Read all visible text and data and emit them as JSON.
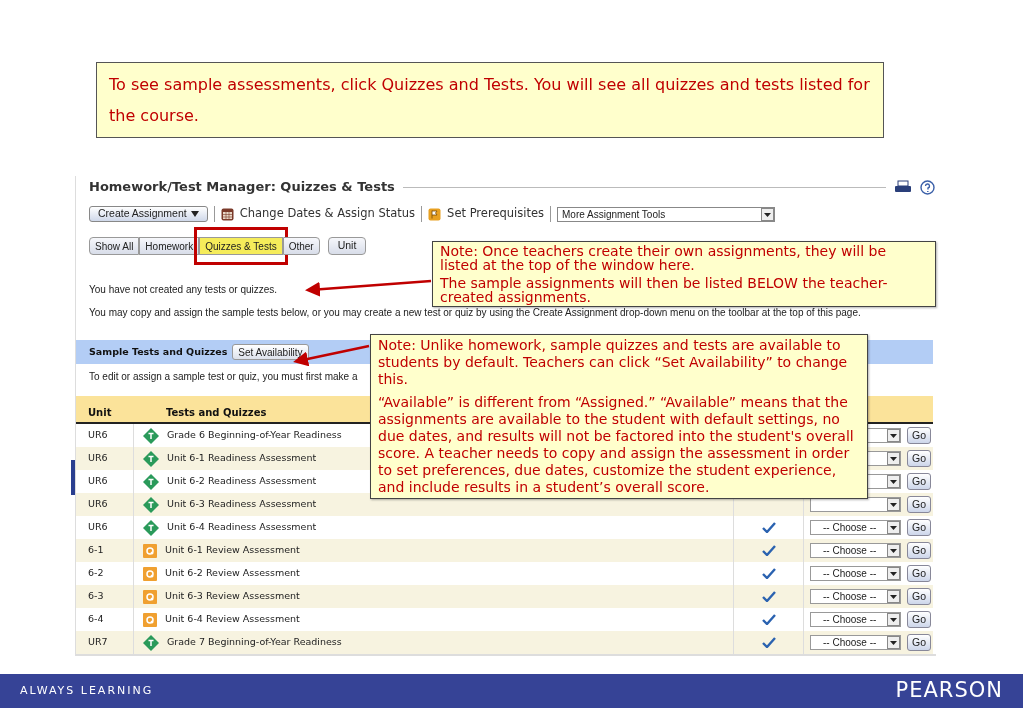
{
  "caption": "To see sample assessments, click Quizzes and Tests. You will see all quizzes and tests listed for the course.",
  "page": {
    "title": "Homework/Test Manager: Quizzes & Tests",
    "toolbar": {
      "create_button": "Create Assignment",
      "change_dates": "Change Dates & Assign Status",
      "prerequisites": "Set Prerequisites",
      "more_tools": "More Assignment Tools"
    },
    "filters": [
      {
        "label": "Show All",
        "selected": false
      },
      {
        "label": "Homework",
        "selected": false
      },
      {
        "label": "Quizzes & Tests",
        "selected": true
      },
      {
        "label": "Other",
        "selected": false
      }
    ],
    "unit_button": "Unit",
    "messages": [
      "You have not created any tests or quizzes.",
      "You may copy and assign the sample tests below, or you may create a new test or quiz by using the Create Assignment drop-down menu on the toolbar at the top of this page."
    ],
    "sample_section": {
      "title": "Sample Tests and Quizzes",
      "button": "Set Availability",
      "note": "To edit or assign a sample test or quiz, you must first make a"
    },
    "table": {
      "columns": [
        "Unit",
        "Tests and Quizzes"
      ],
      "rows": [
        {
          "unit": "UR6",
          "kind": "test",
          "title": "Grade 6 Beginning-of-Year Readiness",
          "go": "Go"
        },
        {
          "unit": "UR6",
          "kind": "test",
          "title": "Unit 6-1 Readiness Assessment",
          "go": "Go"
        },
        {
          "unit": "UR6",
          "kind": "test",
          "title": "Unit 6-2 Readiness Assessment",
          "go": "Go"
        },
        {
          "unit": "UR6",
          "kind": "test",
          "title": "Unit 6-3 Readiness Assessment",
          "go": "Go"
        },
        {
          "unit": "UR6",
          "kind": "test",
          "title": "Unit 6-4 Readiness Assessment",
          "available": true,
          "choose": "-- Choose --",
          "go": "Go"
        },
        {
          "unit": "6-1",
          "kind": "quiz",
          "title": "Unit 6-1 Review Assessment",
          "available": true,
          "choose": "-- Choose --",
          "go": "Go"
        },
        {
          "unit": "6-2",
          "kind": "quiz",
          "title": "Unit 6-2 Review Assessment",
          "available": true,
          "choose": "-- Choose --",
          "go": "Go"
        },
        {
          "unit": "6-3",
          "kind": "quiz",
          "title": "Unit 6-3 Review Assessment",
          "available": true,
          "choose": "-- Choose --",
          "go": "Go"
        },
        {
          "unit": "6-4",
          "kind": "quiz",
          "title": "Unit 6-4 Review Assessment",
          "available": true,
          "choose": "-- Choose --",
          "go": "Go"
        },
        {
          "unit": "UR7",
          "kind": "test",
          "title": "Grade 7 Beginning-of-Year Readiness",
          "available": true,
          "choose": "-- Choose --",
          "go": "Go"
        }
      ]
    }
  },
  "callouts": [
    {
      "paragraphs": [
        "Note: Once teachers create their own assignments, they will be listed at the top of the window here.",
        "The sample assignments will then be listed BELOW the teacher-created assignments."
      ]
    },
    {
      "paragraphs": [
        "Note: Unlike homework, sample quizzes and tests are available to students by default. Teachers can click “Set Availability” to change this.",
        "“Available” is different from “Assigned.” “Available” means that the assignments are available to the student with default settings, no due dates, and results will not be factored into the student's overall score. A teacher needs to copy and assign the assessment in order to set preferences, due dates, customize the student experience, and include results in a student’s overall score."
      ]
    }
  ],
  "footer": {
    "tagline": "ALWAYS LEARNING",
    "brand": "PEARSON"
  }
}
